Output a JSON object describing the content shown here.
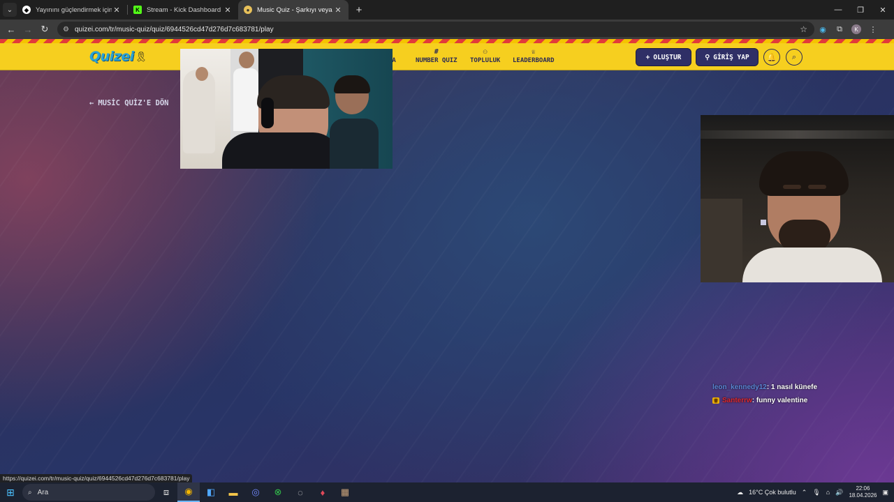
{
  "browser": {
    "tabs": [
      {
        "title": "Yayınını güçlendirmek için en iyi",
        "active": false
      },
      {
        "title": "Stream - Kick Dashboard",
        "active": false
      },
      {
        "title": "Music Quiz - Şarkıyı veya sanatçı",
        "active": true
      }
    ],
    "url": "quizei.com/tr/music-quiz/quiz/6944526cd47d276d7c683781/play",
    "profile_initial": "K"
  },
  "site": {
    "logo": "Quizei",
    "nav": [
      "ÍA",
      "NUMBER QUIZ",
      "TOPLULUK",
      "LEADERBOARD"
    ],
    "create_label": "OLUŞTUR",
    "login_label": "GİRİŞ YAP",
    "back_label": "MUSİC QUİZ'E DÖN"
  },
  "chat": [
    {
      "user": "leon_kennedy12",
      "message": ": 1 nasıl künefe"
    },
    {
      "user": "Santerrw",
      "message": ": funny valentine"
    }
  ],
  "status_bar_url": "https://quizei.com/tr/music-quiz/quiz/6944526cd47d276d7c683781/play",
  "taskbar": {
    "search_placeholder": "Ara",
    "weather": "16°C  Çok bulutlu",
    "time": "22:06",
    "date": "18.04.2026"
  },
  "colors": {
    "header": "#f6cf1f",
    "nav_text": "#2b2a55",
    "button": "#2f2f66"
  }
}
